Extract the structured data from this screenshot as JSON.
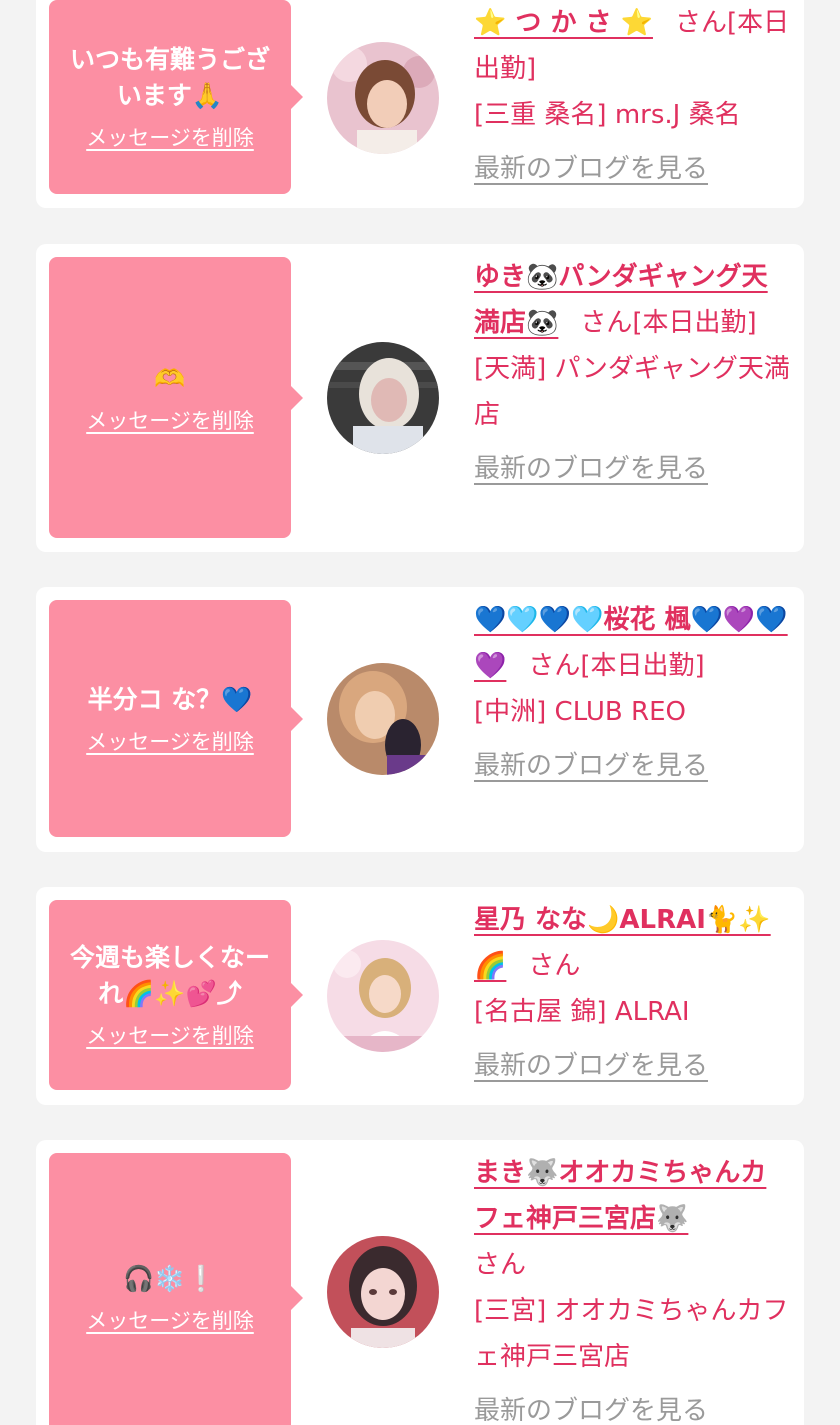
{
  "delete_label": "メッセージを削除",
  "blog_label": "最新のブログを見る",
  "san_label": "さん",
  "colors": {
    "page_bg": "#f3f3f3",
    "card_bg": "#ffffff",
    "bubble": "#fc8fa3",
    "accent_text": "#e0305f",
    "muted_link": "#9a9a9a"
  },
  "messages": [
    {
      "message": "いつも有難うございます🙏",
      "name": "⭐️ つ か さ ⭐️",
      "status": "[本日出勤]",
      "shop": "[三重 桑名] mrs.J 桑名"
    },
    {
      "message": "🫶",
      "name": "ゆき🐼パンダギャング天満店🐼",
      "status": "[本日出勤]",
      "shop": "[天満] パンダギャング天満店"
    },
    {
      "message": "半分コ な？💙",
      "name": "💙🩵💙🩵桜花 楓💙💜💙💜",
      "status": "[本日出勤]",
      "shop": "[中洲] CLUB REO"
    },
    {
      "message": "今週も楽しくなーれ🌈✨💕⤴",
      "name": "星乃 なな🌙ALRAI🐈✨🌈",
      "status": "",
      "shop": "[名古屋 錦] ALRAI"
    },
    {
      "message": "🎧❄️❕",
      "name": "まき🐺オオカミちゃんカフェ神戸三宮店🐺",
      "status": "",
      "shop": "[三宮] オオカミちゃんカフェ神戸三宮店"
    }
  ]
}
